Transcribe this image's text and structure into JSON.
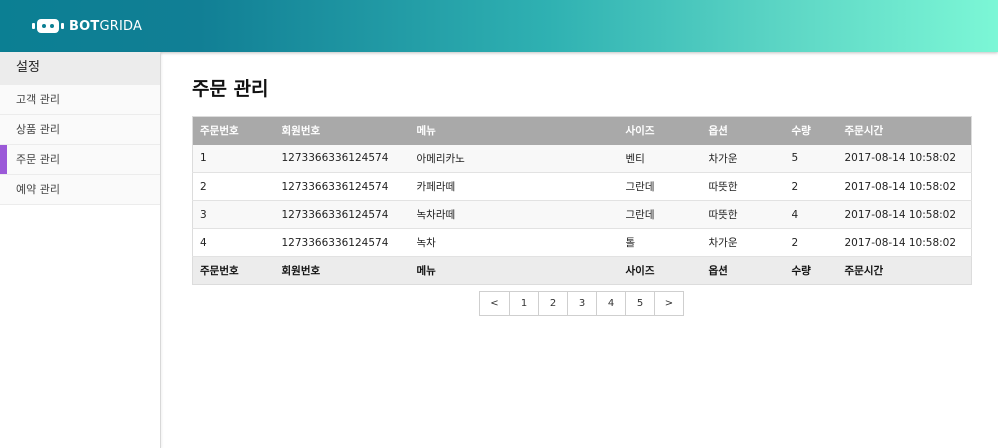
{
  "brand": {
    "bold": "BOT",
    "light": "GRIDA"
  },
  "sidebar": {
    "header": "설정",
    "items": [
      {
        "label": "고객 관리",
        "active": false
      },
      {
        "label": "상품 관리",
        "active": false
      },
      {
        "label": "주문 관리",
        "active": true
      },
      {
        "label": "예약 관리",
        "active": false
      }
    ]
  },
  "page": {
    "title": "주문 관리"
  },
  "table": {
    "columns": [
      "주문번호",
      "회원번호",
      "메뉴",
      "사이즈",
      "옵션",
      "수량",
      "주문시간"
    ],
    "rows": [
      [
        "1",
        "1273366336124574",
        "아메리카노",
        "벤티",
        "차가운",
        "5",
        "2017-08-14 10:58:02"
      ],
      [
        "2",
        "1273366336124574",
        "카페라떼",
        "그란데",
        "따뜻한",
        "2",
        "2017-08-14 10:58:02"
      ],
      [
        "3",
        "1273366336124574",
        "녹차라떼",
        "그란데",
        "따뜻한",
        "4",
        "2017-08-14 10:58:02"
      ],
      [
        "4",
        "1273366336124574",
        "녹차",
        "톨",
        "차가운",
        "2",
        "2017-08-14 10:58:02"
      ]
    ]
  },
  "pagination": {
    "prev": "<",
    "pages": [
      "1",
      "2",
      "3",
      "4",
      "5"
    ],
    "next": ">"
  },
  "colors": {
    "accent": "#9b59d8",
    "header_bg": "#a9a9a9",
    "gradient_start": "#0b7f93",
    "gradient_end": "#7cf7d6"
  }
}
